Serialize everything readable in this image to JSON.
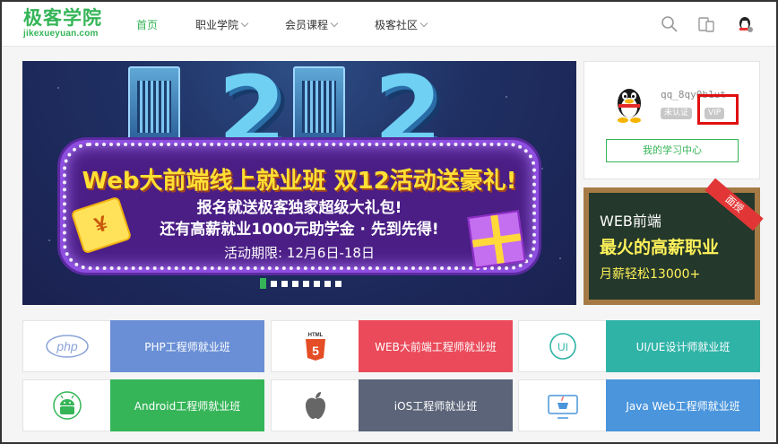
{
  "header": {
    "logo_cn": "极客学院",
    "logo_en": "jikexueyuan.com",
    "nav": [
      {
        "label": "首页",
        "active": true,
        "dropdown": false
      },
      {
        "label": "职业学院",
        "active": false,
        "dropdown": true
      },
      {
        "label": "会员课程",
        "active": false,
        "dropdown": true
      },
      {
        "label": "极客社区",
        "active": false,
        "dropdown": true
      }
    ],
    "icons": [
      "search-icon",
      "devices-icon",
      "user-avatar-icon"
    ]
  },
  "banner": {
    "title": "Web大前端线上就业班  双12活动送豪礼!",
    "line1": "报名就送极客独家超级大礼包!",
    "line2": "还有高薪就业1000元助学金 · 先到先得!",
    "date": "活动期限: 12月6日-18日",
    "big_text": "2",
    "coin_symbol": "¥",
    "slide_count": 8,
    "active_slide": 1
  },
  "user_card": {
    "username": "qq_8qy0b1ut",
    "badge_unverified": "未认证",
    "badge_vip": "VIP",
    "learn_center": "我的学习中心"
  },
  "promo": {
    "line1": "WEB前端",
    "line2": "最火的高薪职业",
    "line3": "月薪轻松13000+",
    "ribbon": "面授"
  },
  "courses": [
    {
      "label": "PHP工程师就业班",
      "icon": "php-icon",
      "icon_text": "php",
      "color": "#6a8fd6"
    },
    {
      "label": "WEB大前端工程师就业班",
      "icon": "html5-icon",
      "icon_text": "HTML",
      "color": "#ea4a5a"
    },
    {
      "label": "UI/UE设计师就业班",
      "icon": "ui-icon",
      "icon_text": "UI",
      "color": "#2fb3a7"
    },
    {
      "label": "Android工程师就业班",
      "icon": "android-icon",
      "icon_text": "",
      "color": "#35b558"
    },
    {
      "label": "iOS工程师就业班",
      "icon": "apple-icon",
      "icon_text": "",
      "color": "#5b6478"
    },
    {
      "label": "Java Web工程师就业班",
      "icon": "java-icon",
      "icon_text": "",
      "color": "#4a95dc"
    }
  ]
}
